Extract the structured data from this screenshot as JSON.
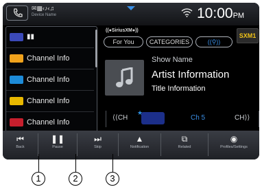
{
  "status_bar": {
    "device_label": "Device Name",
    "clock_time": "10:00",
    "clock_ampm": "PM"
  },
  "channel_list": [
    {
      "label": "",
      "logo_color": "#3b49b8"
    },
    {
      "label": "Channel Info",
      "logo_color": "#f0a21c"
    },
    {
      "label": "Channel Info",
      "logo_color": "#1d8bd8"
    },
    {
      "label": "Channel Info",
      "logo_color": "#e8b800"
    },
    {
      "label": "Channel Info",
      "logo_color": "#c61f2d"
    }
  ],
  "tabs": {
    "for_you": "For You",
    "categories": "CATEGORIES"
  },
  "badge": "SXM1",
  "now_playing": {
    "show_name": "Show Name",
    "artist": "Artist Information",
    "title": "Title Information"
  },
  "channel_nav": {
    "prev": "CH",
    "current": "Ch 5",
    "next": "CH"
  },
  "bottom_buttons": [
    {
      "icon": "skip-back-icon",
      "label": "Back"
    },
    {
      "icon": "pause-icon",
      "label": "Pause"
    },
    {
      "icon": "skip-forward-icon",
      "label": "Skip"
    },
    {
      "icon": "notification-icon",
      "label": "Notification"
    },
    {
      "icon": "related-icon",
      "label": "Related"
    },
    {
      "icon": "profile-settings-icon",
      "label": "Profiles/Settings"
    }
  ],
  "callouts": [
    "1",
    "2",
    "3"
  ],
  "colors": {
    "accent_blue": "#3a8fe6",
    "badge_yellow": "#f2c418"
  }
}
